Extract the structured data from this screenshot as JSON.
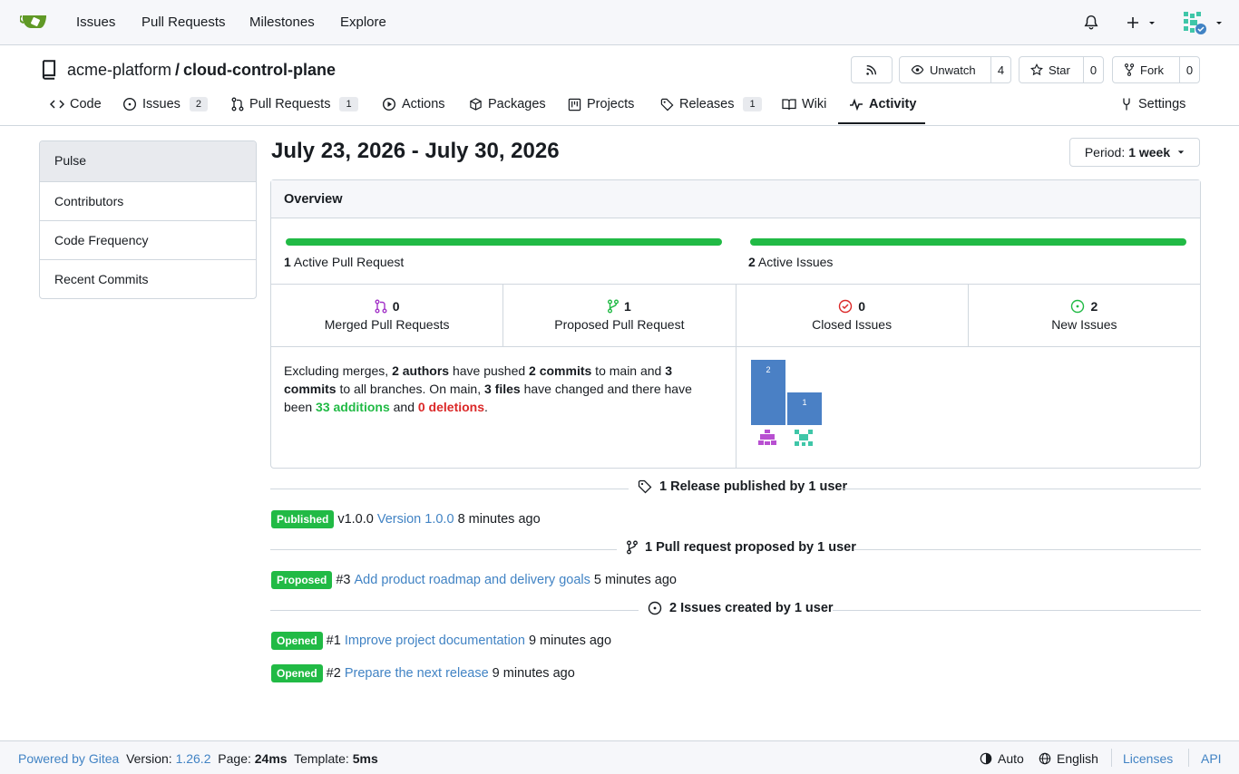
{
  "nav": {
    "items": [
      "Issues",
      "Pull Requests",
      "Milestones",
      "Explore"
    ]
  },
  "repo": {
    "owner": "acme-platform",
    "separator": "/",
    "name": "cloud-control-plane",
    "watch_label": "Unwatch",
    "watch_count": "4",
    "star_label": "Star",
    "star_count": "0",
    "fork_label": "Fork",
    "fork_count": "0"
  },
  "tabs": {
    "code": "Code",
    "issues": "Issues",
    "issues_count": "2",
    "pulls": "Pull Requests",
    "pulls_count": "1",
    "actions": "Actions",
    "packages": "Packages",
    "projects": "Projects",
    "releases": "Releases",
    "releases_count": "1",
    "wiki": "Wiki",
    "activity": "Activity",
    "settings": "Settings"
  },
  "sidebar": {
    "items": [
      "Pulse",
      "Contributors",
      "Code Frequency",
      "Recent Commits"
    ]
  },
  "main": {
    "date_range": "July 23, 2026 - July 30, 2026",
    "period_label": "Period:",
    "period_value": "1 week"
  },
  "overview": {
    "title": "Overview",
    "active_prs_count": "1",
    "active_prs_label": "Active Pull Request",
    "active_issues_count": "2",
    "active_issues_label": "Active Issues",
    "stats": [
      {
        "num": "0",
        "label": "Merged Pull Requests"
      },
      {
        "num": "1",
        "label": "Proposed Pull Request"
      },
      {
        "num": "0",
        "label": "Closed Issues"
      },
      {
        "num": "2",
        "label": "New Issues"
      }
    ],
    "commits": {
      "p1": "Excluding merges, ",
      "authors": "2 authors",
      "p2": " have pushed ",
      "commits_main": "2 commits",
      "p3": " to main and ",
      "commits_all": "3 commits",
      "p4": " to all branches. On main, ",
      "files": "3 files",
      "p5": " have changed and there have been ",
      "additions": "33 additions",
      "p6": " and ",
      "deletions": "0 deletions",
      "p7": "."
    },
    "author_bars": [
      {
        "value": 2,
        "label": "2"
      },
      {
        "value": 1,
        "label": "1"
      }
    ]
  },
  "activity": {
    "release_header": "1 Release published by 1 user",
    "release": {
      "label": "Published",
      "tag": "v1.0.0",
      "title": "Version 1.0.0",
      "time": "8 minutes ago"
    },
    "pr_header": "1 Pull request proposed by 1 user",
    "pr": {
      "label": "Proposed",
      "num": "#3",
      "title": "Add product roadmap and delivery goals",
      "time": "5 minutes ago"
    },
    "issues_header": "2 Issues created by 1 user",
    "issues": [
      {
        "label": "Opened",
        "num": "#1",
        "title": "Improve project documentation",
        "time": "9 minutes ago"
      },
      {
        "label": "Opened",
        "num": "#2",
        "title": "Prepare the next release",
        "time": "9 minutes ago"
      }
    ]
  },
  "footer": {
    "powered": "Powered by Gitea",
    "version_label": "Version:",
    "version": "1.26.2",
    "page_label": "Page:",
    "page_time": "24ms",
    "template_label": "Template:",
    "template_time": "5ms",
    "theme": "Auto",
    "language": "English",
    "licenses": "Licenses",
    "api": "API"
  }
}
